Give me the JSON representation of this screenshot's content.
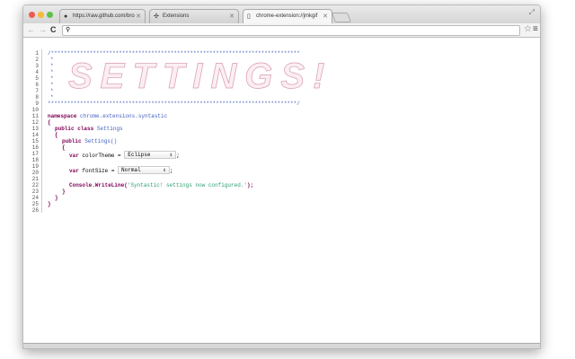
{
  "tabs": [
    {
      "title": "https://raw.github.com/bro",
      "icon": "github-icon"
    },
    {
      "title": "Extensions",
      "icon": "puzzle-icon"
    },
    {
      "title": "chrome-extension://jmkgif",
      "icon": "page-icon",
      "active": true
    }
  ],
  "omnibox": {
    "value": ""
  },
  "banner": {
    "art_text": "SETTINGS!",
    "comment_open": "/*****************************************************************************",
    "comment_close": "*****************************************************************************/",
    "star": "*"
  },
  "code": {
    "namespace_kw": "namespace",
    "namespace_name": "chrome.extensions.syntastic",
    "open": "{",
    "close": "}",
    "public": "public",
    "class": "class",
    "class_name": "Settings",
    "ctor": "Settings()",
    "var": "var",
    "color_var": "colorTheme =",
    "font_var": "fontSize =",
    "semi": ";",
    "console": "Console.WriteLine(",
    "message": "'Syntastic! settings now configured.'",
    "console_end": ");"
  },
  "selects": {
    "color_theme": "Eclipse",
    "font_size": "Normal"
  },
  "line_numbers": [
    "1",
    "2",
    "3",
    "4",
    "5",
    "6",
    "7",
    "8",
    "9",
    "10",
    "11",
    "12",
    "13",
    "14",
    "15",
    "16",
    "17",
    "18",
    "19",
    "20",
    "21",
    "22",
    "23",
    "24",
    "25",
    "26"
  ]
}
